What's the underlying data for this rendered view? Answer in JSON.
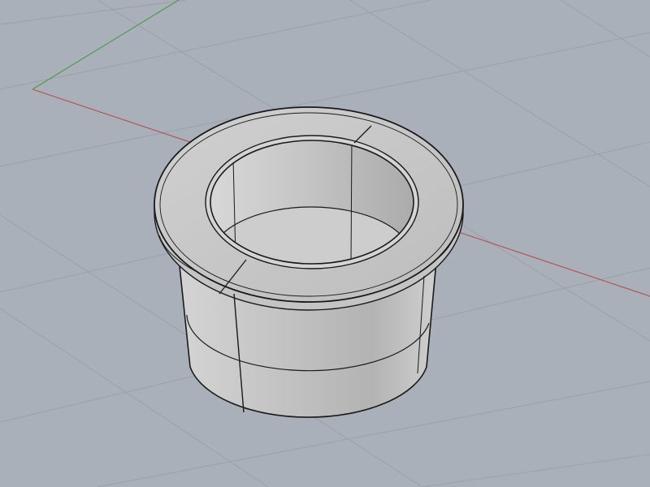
{
  "viewport": {
    "background_color": "#a9b0b9",
    "grid_color": "#9aa1aa",
    "x_axis_color": "#b5514a",
    "y_axis_color": "#4a9a48",
    "model": {
      "kind": "flanged bushing",
      "surface_color": "#c2c2c2",
      "edge_color": "#1a1a1a"
    }
  }
}
